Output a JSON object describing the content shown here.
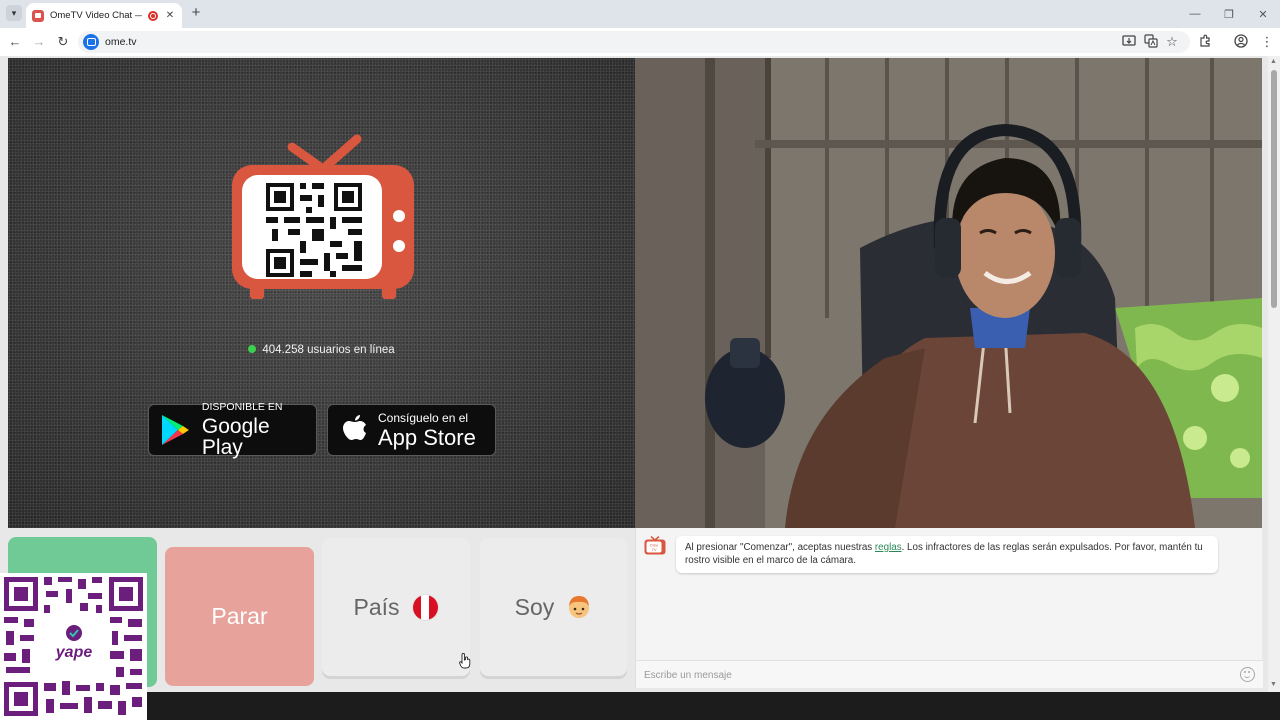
{
  "browser": {
    "tab_title": "OmeTV Video Chat — Ome",
    "tab_close": "✕",
    "new_tab": "+",
    "url": "ome.tv",
    "win_minimize": "—",
    "win_restore": "❐",
    "win_close": "✕"
  },
  "stranger": {
    "online_text": "404.258 usuarios en línea",
    "google_play": {
      "small": "DISPONIBLE EN",
      "big": "Google Play"
    },
    "app_store": {
      "small": "Consíguelo en el",
      "big": "App Store"
    }
  },
  "controls": {
    "stop_label": "Parar",
    "country_label": "País",
    "gender_label": "Soy"
  },
  "chat": {
    "logo_text_top": "Ome",
    "logo_text_bottom": "TV",
    "message_before": "Al presionar \"Comenzar\", aceptas nuestras ",
    "message_link": "reglas",
    "message_after": ". Los infractores de las reglas serán expulsados. Por favor, mantén tu rostro visible en el marco de la cámara.",
    "input_placeholder": "Escribe un mensaje"
  },
  "overlay": {
    "yape_text": "yape"
  },
  "colors": {
    "start_green": "#6fca95",
    "stop_red": "#e7a39b",
    "tv_red": "#d9573f",
    "online_green": "#3ccf4e",
    "link_green": "#2a8a57",
    "yape_purple": "#6b1e7c"
  }
}
